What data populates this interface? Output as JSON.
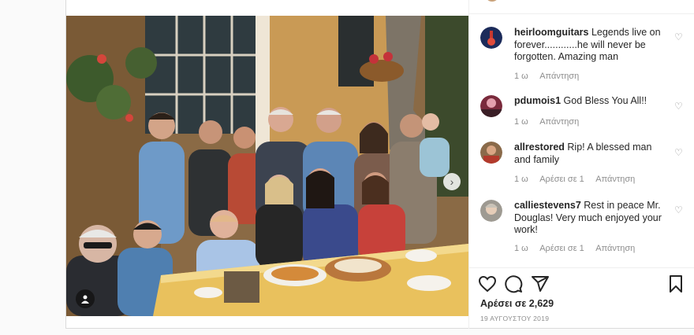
{
  "post": {
    "photo_alt": "family-photo",
    "comments": [
      {
        "username": "heirloomguitars",
        "text": "Legends live on forever............he will never be forgotten. Amazing man",
        "time": "1 ω",
        "likes": "",
        "reply": "Απάντηση"
      },
      {
        "username": "pdumois1",
        "text": "God Bless You All!!",
        "time": "1 ω",
        "likes": "",
        "reply": "Απάντηση"
      },
      {
        "username": "allrestored",
        "text": "Rip! A blessed man and family",
        "time": "1 ω",
        "likes": "Αρέσει σε 1",
        "reply": "Απάντηση"
      },
      {
        "username": "calliestevens7",
        "text": "Rest in peace Mr. Douglas! Very much enjoyed your work!",
        "time": "1 ω",
        "likes": "Αρέσει σε 1",
        "reply": "Απάντηση"
      }
    ],
    "likes_count": "Αρέσει σε 2,629",
    "date": "19 ΑΥΓΟΥΣΤΟΥ 2019"
  },
  "icons": {
    "like": "heart-icon",
    "comment": "comment-icon",
    "share": "share-icon",
    "save": "bookmark-icon",
    "next": "chevron-right-icon",
    "tags": "user-tag-icon"
  }
}
